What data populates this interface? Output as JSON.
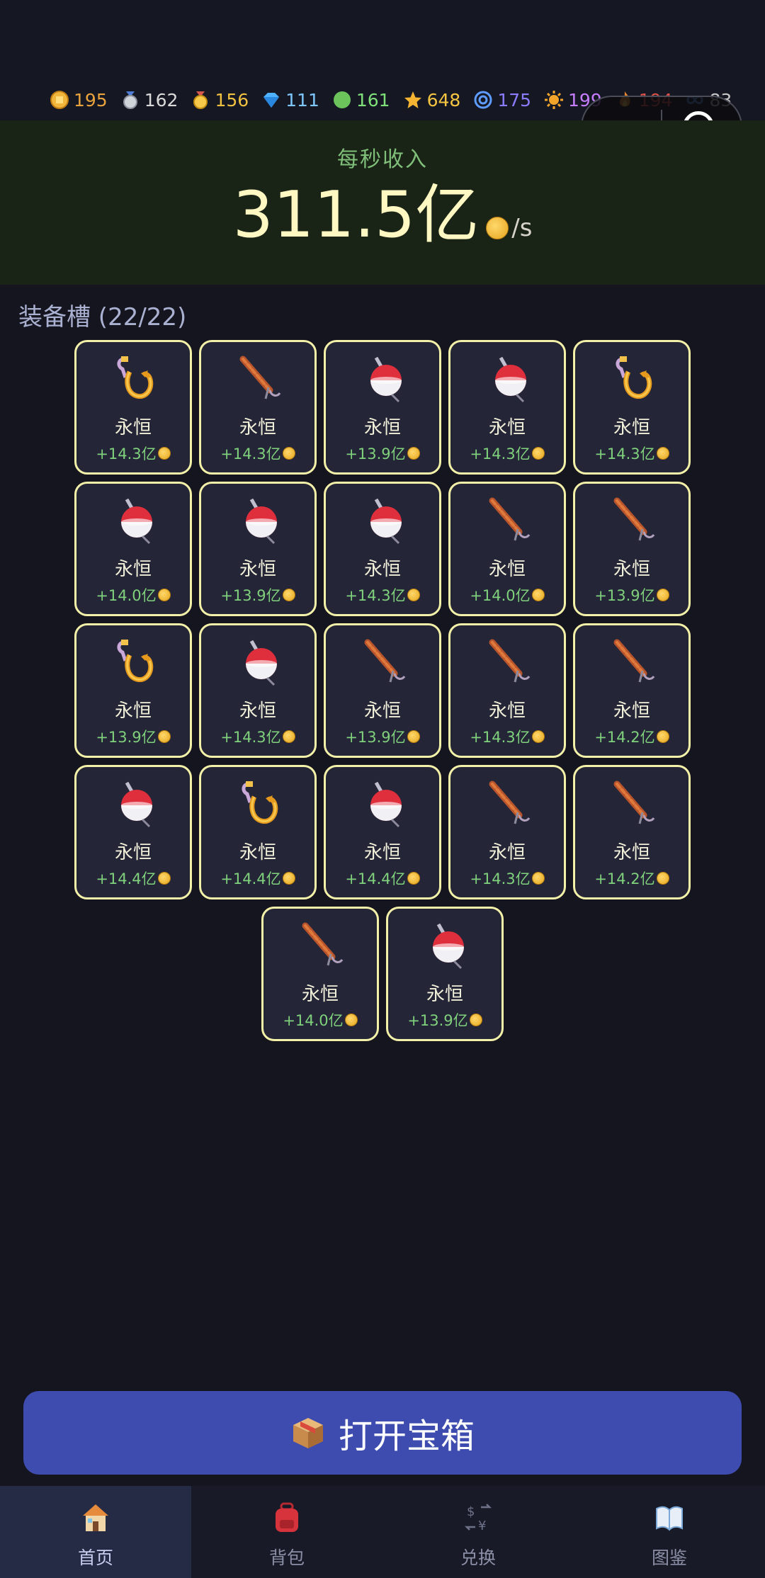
{
  "resources": [
    {
      "icon": "coin-icon",
      "value": "195",
      "color": "#e8a33c"
    },
    {
      "icon": "silver-medal-icon",
      "value": "162",
      "color": "#d9d9d9"
    },
    {
      "icon": "gold-medal-icon",
      "value": "156",
      "color": "#f0c040"
    },
    {
      "icon": "diamond-icon",
      "value": "111",
      "color": "#7fc8ff"
    },
    {
      "icon": "green-orb-icon",
      "value": "161",
      "color": "#7fe07a"
    },
    {
      "icon": "star-icon",
      "value": "648",
      "color": "#f5c542"
    },
    {
      "icon": "swirl-icon",
      "value": "175",
      "color": "#8a7cff"
    },
    {
      "icon": "sun-icon",
      "value": "199",
      "color": "#c77dff"
    },
    {
      "icon": "flame-icon",
      "value": "194",
      "color": "#e0504a"
    },
    {
      "icon": "infinity-icon",
      "value": "83",
      "color": "#c7c7c7"
    }
  ],
  "income": {
    "label": "每秒收入",
    "value": "311.5亿",
    "unit": "/s"
  },
  "equipment": {
    "title": "装备槽 (22/22)",
    "slots": [
      {
        "icon": "hook-icon",
        "name": "永恒",
        "value": "+14.3亿"
      },
      {
        "icon": "fishing-rod-icon",
        "name": "永恒",
        "value": "+14.3亿"
      },
      {
        "icon": "float-icon",
        "name": "永恒",
        "value": "+13.9亿"
      },
      {
        "icon": "float-icon",
        "name": "永恒",
        "value": "+14.3亿"
      },
      {
        "icon": "hook-icon",
        "name": "永恒",
        "value": "+14.3亿"
      },
      {
        "icon": "float-icon",
        "name": "永恒",
        "value": "+14.0亿"
      },
      {
        "icon": "float-icon",
        "name": "永恒",
        "value": "+13.9亿"
      },
      {
        "icon": "float-icon",
        "name": "永恒",
        "value": "+14.3亿"
      },
      {
        "icon": "fishing-rod-icon",
        "name": "永恒",
        "value": "+14.0亿"
      },
      {
        "icon": "fishing-rod-icon",
        "name": "永恒",
        "value": "+13.9亿"
      },
      {
        "icon": "hook-icon",
        "name": "永恒",
        "value": "+13.9亿"
      },
      {
        "icon": "float-icon",
        "name": "永恒",
        "value": "+14.3亿"
      },
      {
        "icon": "fishing-rod-icon",
        "name": "永恒",
        "value": "+13.9亿"
      },
      {
        "icon": "fishing-rod-icon",
        "name": "永恒",
        "value": "+14.3亿"
      },
      {
        "icon": "fishing-rod-icon",
        "name": "永恒",
        "value": "+14.2亿"
      },
      {
        "icon": "float-icon",
        "name": "永恒",
        "value": "+14.4亿"
      },
      {
        "icon": "hook-icon",
        "name": "永恒",
        "value": "+14.4亿"
      },
      {
        "icon": "float-icon",
        "name": "永恒",
        "value": "+14.4亿"
      },
      {
        "icon": "fishing-rod-icon",
        "name": "永恒",
        "value": "+14.3亿"
      },
      {
        "icon": "fishing-rod-icon",
        "name": "永恒",
        "value": "+14.2亿"
      },
      {
        "icon": "fishing-rod-icon",
        "name": "永恒",
        "value": "+14.0亿"
      },
      {
        "icon": "float-icon",
        "name": "永恒",
        "value": "+13.9亿"
      }
    ]
  },
  "open_button": {
    "label": "打开宝箱",
    "icon": "package-icon"
  },
  "tabs": [
    {
      "label": "首页",
      "icon": "home-icon",
      "active": true
    },
    {
      "label": "背包",
      "icon": "backpack-icon",
      "active": false
    },
    {
      "label": "兑换",
      "icon": "exchange-icon",
      "active": false
    },
    {
      "label": "图鉴",
      "icon": "book-icon",
      "active": false
    }
  ]
}
